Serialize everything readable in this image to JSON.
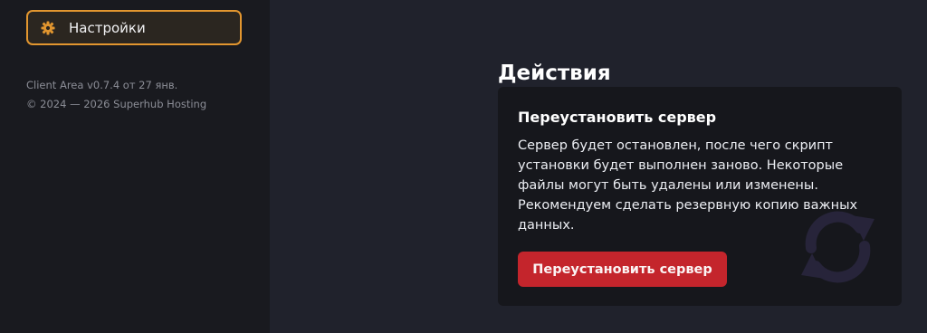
{
  "sidebar": {
    "active_item": {
      "label": "Настройки",
      "icon": "gear-icon"
    },
    "version": "Client Area v0.7.4 от 27 янв.",
    "copyright": "© 2024 — 2026 Superhub Hosting"
  },
  "main": {
    "section_title": "Действия",
    "reinstall_card": {
      "title": "Переустановить сервер",
      "description": "Сервер будет остановлен, после чего скрипт установки будет выполнен заново. Некоторые файлы могут быть удалены или изменены. Рекомендуем сделать резервную копию важных данных.",
      "button_label": "Переустановить сервер",
      "background_icon": "refresh-icon"
    }
  },
  "colors": {
    "accent": "#e2962f",
    "danger": "#c4252c",
    "page_background": "#20222c",
    "sidebar_background": "#191a1f",
    "card_background": "#16171c"
  }
}
